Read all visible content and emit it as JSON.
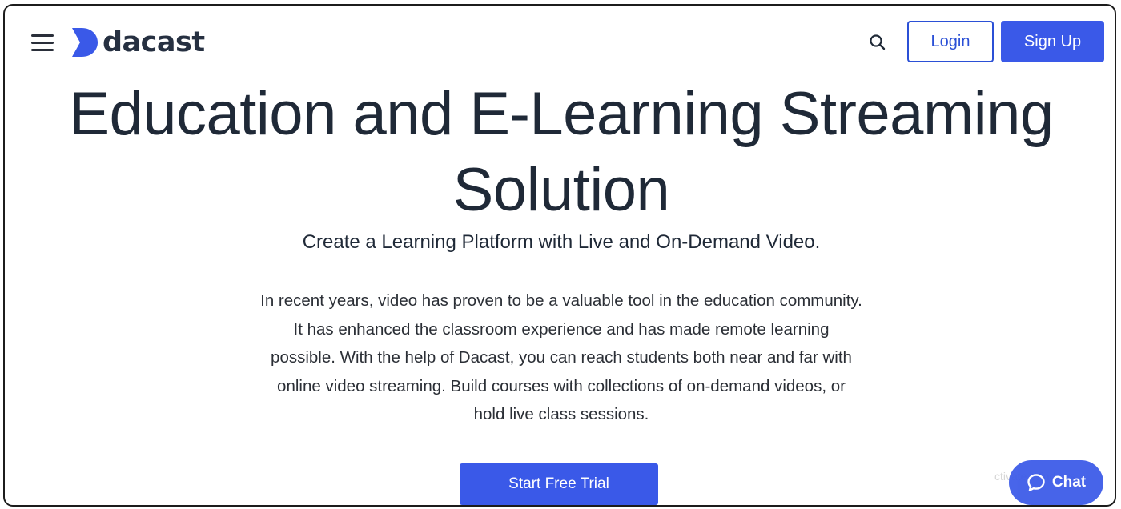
{
  "header": {
    "logo_text": "dacast",
    "login_label": "Login",
    "signup_label": "Sign Up",
    "icons": [
      "menu-icon",
      "search-icon"
    ]
  },
  "hero": {
    "title": "Education and E-Learning Streaming Solution",
    "subtitle": "Create a Learning Platform with Live and On-Demand Video.",
    "body": "In recent years, video has proven to be a valuable tool in the education community. It has enhanced the classroom experience and has made remote learning possible. With the help of Dacast, you can reach students both near and far with online video streaming. Build courses with collections of on-demand videos, or hold live class sessions.",
    "cta_label": "Start Free Trial"
  },
  "chat": {
    "label": "Chat",
    "icon": "chat-bubble-icon"
  },
  "overlay": {
    "watermark_text": "ctivate Windows"
  },
  "colors": {
    "accent": "#3a59e8",
    "login_border": "#2b50d6",
    "text_dark": "#1f2937"
  }
}
